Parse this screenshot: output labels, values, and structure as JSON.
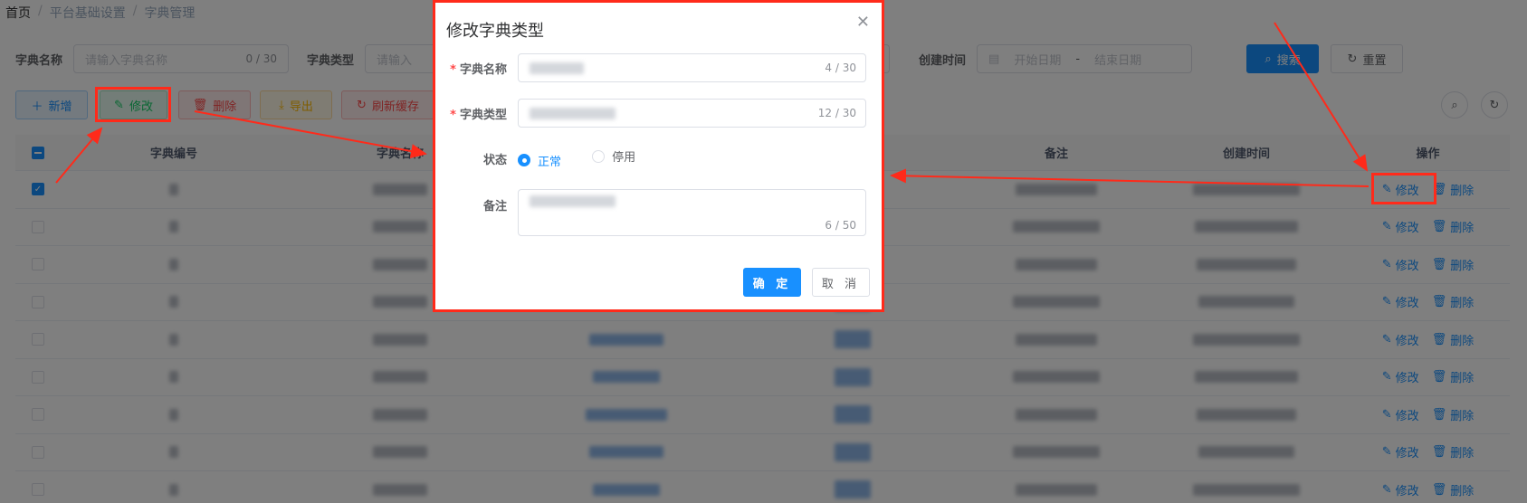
{
  "breadcrumb": [
    "首页",
    "平台基础设置",
    "字典管理"
  ],
  "filters": {
    "dict_name_label": "字典名称",
    "dict_name_placeholder": "请输入字典名称",
    "dict_name_count": "0 / 30",
    "dict_type_label": "字典类型",
    "dict_type_placeholder": "请输入",
    "created_label": "创建时间",
    "start_date": "开始日期",
    "date_sep": "-",
    "end_date": "结束日期",
    "search_label": "搜索",
    "reset_label": "重置"
  },
  "toolbar": {
    "add": "新增",
    "edit": "修改",
    "delete": "删除",
    "export": "导出",
    "refresh": "刷新缓存"
  },
  "table": {
    "headers": [
      "字典编号",
      "字典名称",
      "备注",
      "创建时间",
      "操作"
    ],
    "row_actions": {
      "edit": "修改",
      "delete": "删除"
    },
    "row_count": 9
  },
  "dialog": {
    "title": "修改字典类型",
    "name_label": "字典名称",
    "name_count": "4 / 30",
    "type_label": "字典类型",
    "type_count": "12 / 30",
    "status_label": "状态",
    "status_normal": "正常",
    "status_disabled": "停用",
    "remark_label": "备注",
    "remark_count": "6 / 50",
    "confirm": "确 定",
    "cancel": "取 消"
  },
  "colors": {
    "primary": "#1890ff",
    "annotation_red": "#ff2a1a"
  }
}
